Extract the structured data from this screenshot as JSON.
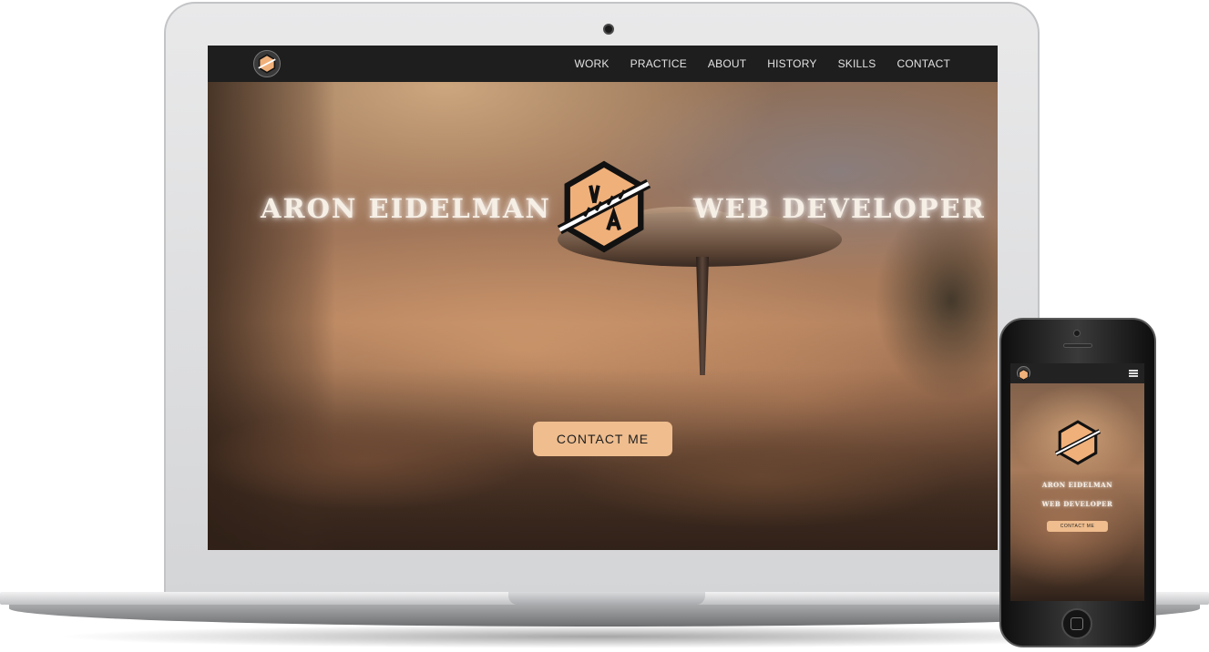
{
  "desktop": {
    "nav": {
      "links": [
        "WORK",
        "PRACTICE",
        "ABOUT",
        "HISTORY",
        "SKILLS",
        "CONTACT"
      ]
    },
    "hero": {
      "name": "ARON EIDELMAN",
      "role": "WEB DEVELOPER",
      "cta_label": "CONTACT ME"
    }
  },
  "mobile": {
    "hero": {
      "name": "ARON EIDELMAN",
      "role": "WEB DEVELOPER",
      "cta_label": "CONTACT ME"
    }
  },
  "icons": {
    "logo": "hexagon-logo-icon",
    "menu": "hamburger-menu-icon"
  },
  "colors": {
    "accent": "#efbd8e",
    "nav_bg": "#1e1e1e",
    "logo_hex": "#f0b07a"
  }
}
